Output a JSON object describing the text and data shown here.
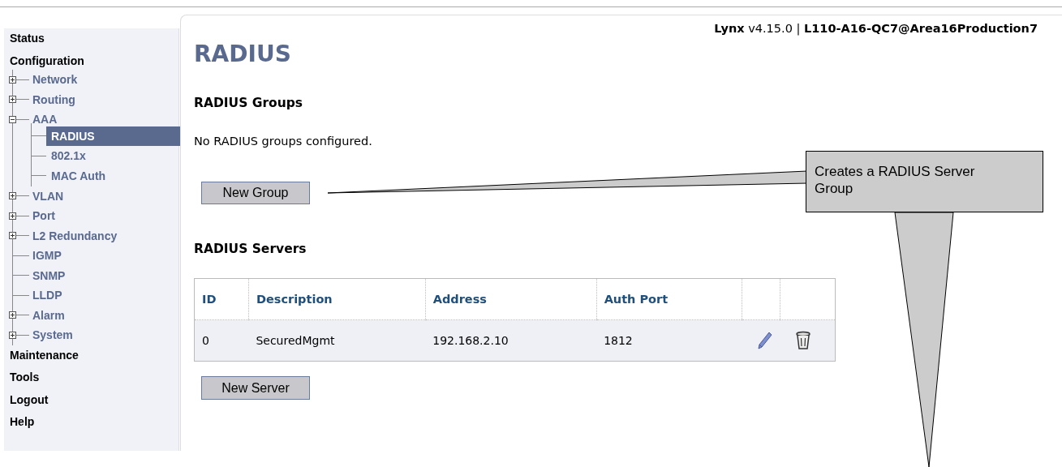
{
  "sidebar": {
    "items": [
      {
        "label": "Status",
        "selected": false
      },
      {
        "label": "Configuration",
        "selected": false,
        "children": [
          {
            "label": "Network",
            "kind": "folder",
            "expanded": false,
            "selected": false
          },
          {
            "label": "Routing",
            "kind": "folder",
            "expanded": false,
            "selected": false
          },
          {
            "label": "AAA",
            "kind": "folder",
            "expanded": true,
            "selected": false,
            "children": [
              {
                "label": "RADIUS",
                "selected": true
              },
              {
                "label": "802.1x",
                "selected": false
              },
              {
                "label": "MAC Auth",
                "selected": false
              }
            ]
          },
          {
            "label": "VLAN",
            "kind": "folder",
            "expanded": false,
            "selected": false
          },
          {
            "label": "Port",
            "kind": "folder",
            "expanded": false,
            "selected": false
          },
          {
            "label": "L2 Redundancy",
            "kind": "folder",
            "expanded": false,
            "selected": false
          },
          {
            "label": "IGMP",
            "kind": "leaf",
            "selected": false
          },
          {
            "label": "SNMP",
            "kind": "leaf",
            "selected": false
          },
          {
            "label": "LLDP",
            "kind": "leaf",
            "selected": false
          },
          {
            "label": "Alarm",
            "kind": "folder",
            "expanded": false,
            "selected": false
          },
          {
            "label": "System",
            "kind": "folder",
            "expanded": false,
            "selected": false
          }
        ]
      },
      {
        "label": "Maintenance",
        "selected": false
      },
      {
        "label": "Tools",
        "selected": false
      },
      {
        "label": "Logout",
        "selected": false
      },
      {
        "label": "Help",
        "selected": false
      }
    ]
  },
  "header": {
    "device_info": "**Lynx** v4.15.0 | **L110-A16-QC7@Area16Production7**"
  },
  "page_title": "RADIUS",
  "groups": {
    "heading": "RADIUS Groups",
    "message": "No RADIUS groups configured.",
    "button": "New Group"
  },
  "servers": {
    "heading": "RADIUS Servers",
    "table": {
      "columns": [
        "ID",
        "Description",
        "Address",
        "Auth Port"
      ],
      "rows": [
        {
          "cells": [
            "0",
            "SecuredMgmt",
            "192.168.2.10",
            "1812"
          ],
          "actions": [
            {
              "kind": "edit"
            },
            {
              "kind": "delete"
            }
          ]
        }
      ]
    },
    "button": "New Server"
  },
  "callout": {
    "text": "Creates a RADIUS Server Group"
  }
}
